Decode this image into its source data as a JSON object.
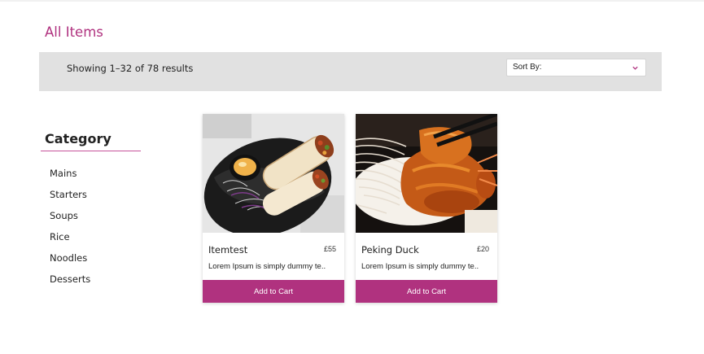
{
  "page": {
    "title": "All Items"
  },
  "results": {
    "summary": "Showing 1–32 of 78 results",
    "sort_label": "Sort By:",
    "sort_icon": "chevron-down-icon"
  },
  "sidebar": {
    "heading": "Category",
    "items": [
      {
        "label": "Mains"
      },
      {
        "label": "Starters"
      },
      {
        "label": "Soups"
      },
      {
        "label": "Rice"
      },
      {
        "label": "Noodles"
      },
      {
        "label": "Desserts"
      }
    ]
  },
  "products": [
    {
      "name": "Itemtest",
      "price": "£55",
      "description": "Lorem Ipsum is simply dummy te..",
      "button_label": "Add to Cart",
      "image": "wrap-with-dip-photo"
    },
    {
      "name": "Peking Duck",
      "price": "£20",
      "description": "Lorem Ipsum is simply dummy te..",
      "button_label": "Add to Cart",
      "image": "peking-duck-photo"
    }
  ],
  "colors": {
    "accent": "#b0327f",
    "bar_background": "#e1e1e1",
    "rule": "#c5519a"
  }
}
